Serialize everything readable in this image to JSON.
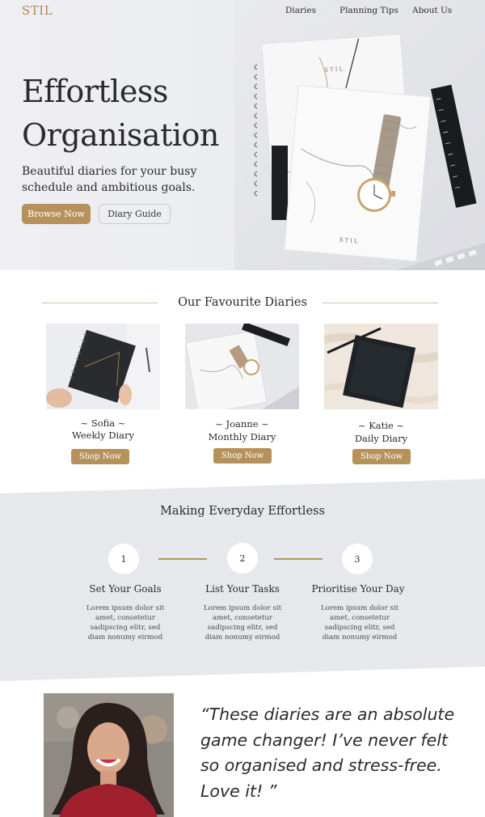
{
  "brand": {
    "logo": "STIL",
    "accent": "#b6925a"
  },
  "nav": {
    "items": [
      "Diaries",
      "Planning Tips",
      "About Us"
    ]
  },
  "hero": {
    "title_line1": "Effortless",
    "title_line2": "Organisation",
    "subtitle": "Beautiful diaries for your busy schedule and ambitious goals.",
    "primary_button": "Browse Now",
    "secondary_button": "Diary Guide",
    "notebook_brand": "STIL"
  },
  "favourites": {
    "title": "Our Favourite Diaries",
    "cards": [
      {
        "name": "~ Sofia ~",
        "type": "Weekly Diary",
        "button": "Shop Now"
      },
      {
        "name": "~ Joanne ~",
        "type": "Monthly Diary",
        "button": "Shop Now"
      },
      {
        "name": "~ Katie ~",
        "type": "Daily Diary",
        "button": "Shop Now"
      }
    ]
  },
  "steps": {
    "title": "Making Everyday Effortless",
    "items": [
      {
        "number": "1",
        "title": "Set Your Goals",
        "body": "Lorem ipsum dolor sit amet, consetetur sadipscing elitr, sed diam nonumy eirmod"
      },
      {
        "number": "2",
        "title": "List Your Tasks",
        "body": "Lorem ipsum dolor sit amet, consetetur sadipscing elitr, sed diam nonumy eirmod"
      },
      {
        "number": "3",
        "title": "Prioritise Your Day",
        "body": "Lorem ipsum dolor sit amet, consetetur sadipscing elitr, sed diam nonumy eirmod"
      }
    ]
  },
  "testimonial": {
    "quote": "“These diaries are an absolute game changer! I’ve never felt so organised and stress-free. Love it! ”"
  }
}
